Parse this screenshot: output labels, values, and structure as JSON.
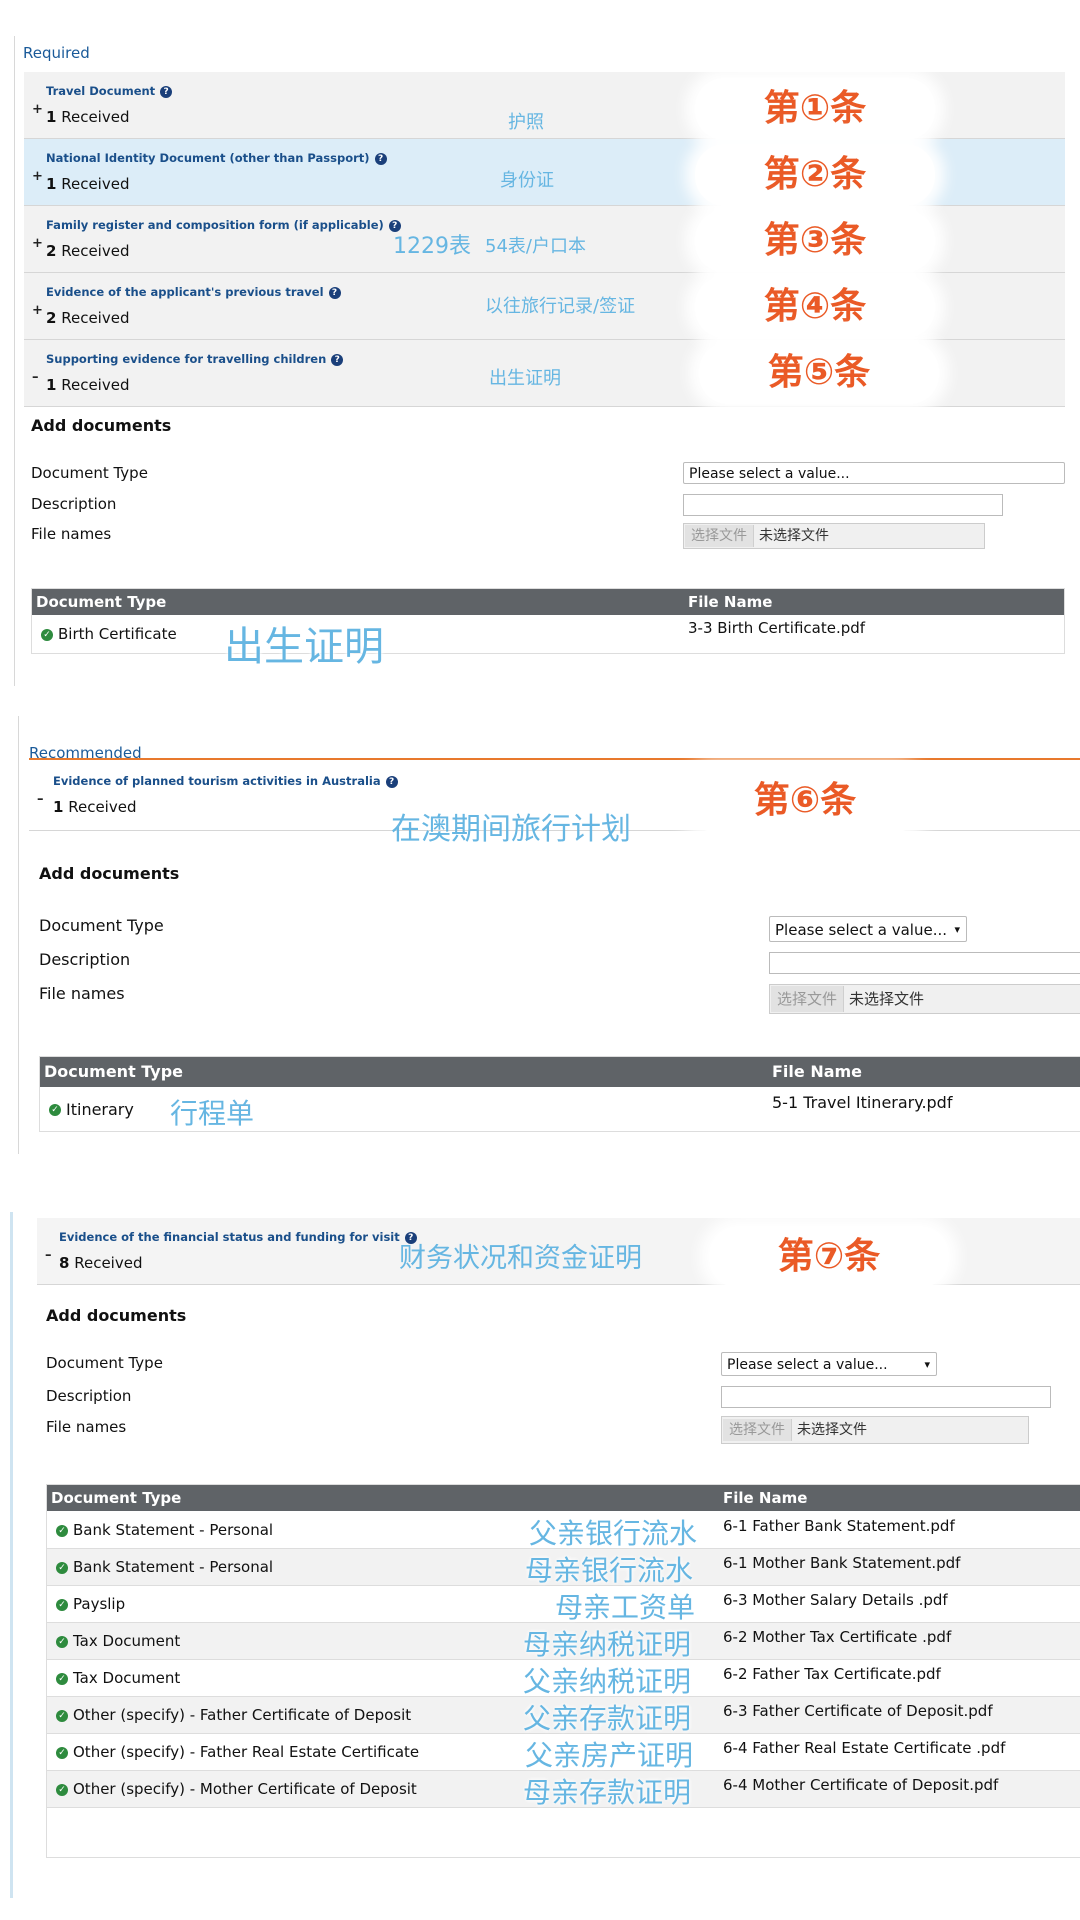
{
  "required": {
    "heading": "Required",
    "items": [
      {
        "toggle": "+",
        "title": "Travel Document",
        "count": "1",
        "received": "Received",
        "note": "护照",
        "badge": "第①条"
      },
      {
        "toggle": "+",
        "title": "National Identity Document (other than Passport)",
        "count": "1",
        "received": "Received",
        "note": "身份证",
        "badge": "第②条"
      },
      {
        "toggle": "+",
        "title": "Family register and composition form (if applicable)",
        "count": "2",
        "received": "Received",
        "note_a": "1229表",
        "note": "54表/户口本",
        "badge": "第③条"
      },
      {
        "toggle": "+",
        "title": "Evidence of the applicant's previous travel",
        "count": "2",
        "received": "Received",
        "note": "以往旅行记录/签证",
        "badge": "第④条"
      },
      {
        "toggle": "–",
        "title": "Supporting evidence for travelling children",
        "count": "1",
        "received": "Received",
        "note": "出生证明",
        "badge": "第⑤条"
      }
    ],
    "add": {
      "heading": "Add documents",
      "doc_type_label": "Document Type",
      "description_label": "Description",
      "file_names_label": "File names",
      "select_value": "Please select a value...",
      "file_button": "选择文件",
      "file_status": "未选择文件"
    },
    "table": {
      "col1": "Document Type",
      "col2": "File Name",
      "rows": [
        {
          "type": "Birth Certificate",
          "file": "3-3 Birth Certificate.pdf",
          "note": "出生证明"
        }
      ]
    }
  },
  "recommended": {
    "heading": "Recommended",
    "item": {
      "toggle": "–",
      "title": "Evidence of planned tourism activities in Australia",
      "count": "1",
      "received": "Received",
      "note": "在澳期间旅行计划",
      "badge": "第⑥条"
    },
    "add": {
      "heading": "Add documents",
      "doc_type_label": "Document Type",
      "description_label": "Description",
      "file_names_label": "File names",
      "select_value": "Please select a value...",
      "file_button": "选择文件",
      "file_status": "未选择文件"
    },
    "table": {
      "col1": "Document Type",
      "col2": "File Name",
      "rows": [
        {
          "type": "Itinerary",
          "file": "5-1 Travel Itinerary.pdf",
          "note": "行程单"
        }
      ]
    }
  },
  "financial": {
    "item": {
      "toggle": "–",
      "title": "Evidence of the financial status and funding for visit",
      "count": "8",
      "received": "Received",
      "note": "财务状况和资金证明",
      "badge": "第⑦条"
    },
    "add": {
      "heading": "Add documents",
      "doc_type_label": "Document Type",
      "description_label": "Description",
      "file_names_label": "File names",
      "select_value": "Please select a value...",
      "file_button": "选择文件",
      "file_status": "未选择文件"
    },
    "table": {
      "col1": "Document Type",
      "col2": "File Name",
      "rows": [
        {
          "type": "Bank Statement - Personal",
          "file": "6-1 Father Bank Statement.pdf",
          "note": "父亲银行流水"
        },
        {
          "type": "Bank Statement - Personal",
          "file": "6-1 Mother Bank Statement.pdf",
          "note": "母亲银行流水"
        },
        {
          "type": "Payslip",
          "file": "6-3 Mother Salary Details .pdf",
          "note": "母亲工资单"
        },
        {
          "type": "Tax Document",
          "file": "6-2 Mother Tax Certificate .pdf",
          "note": "母亲纳税证明"
        },
        {
          "type": "Tax Document",
          "file": "6-2 Father Tax Certificate.pdf",
          "note": "父亲纳税证明"
        },
        {
          "type": "Other (specify) - Father Certificate of Deposit",
          "file": "6-3 Father Certificate of Deposit.pdf",
          "note": "父亲存款证明"
        },
        {
          "type": "Other (specify) - Father Real Estate Certificate",
          "file": "6-4 Father Real Estate Certificate .pdf",
          "note": "父亲房产证明"
        },
        {
          "type": "Other (specify) - Mother Certificate of Deposit",
          "file": "6-4 Mother Certificate of Deposit.pdf",
          "note": "母亲存款证明"
        }
      ]
    }
  }
}
